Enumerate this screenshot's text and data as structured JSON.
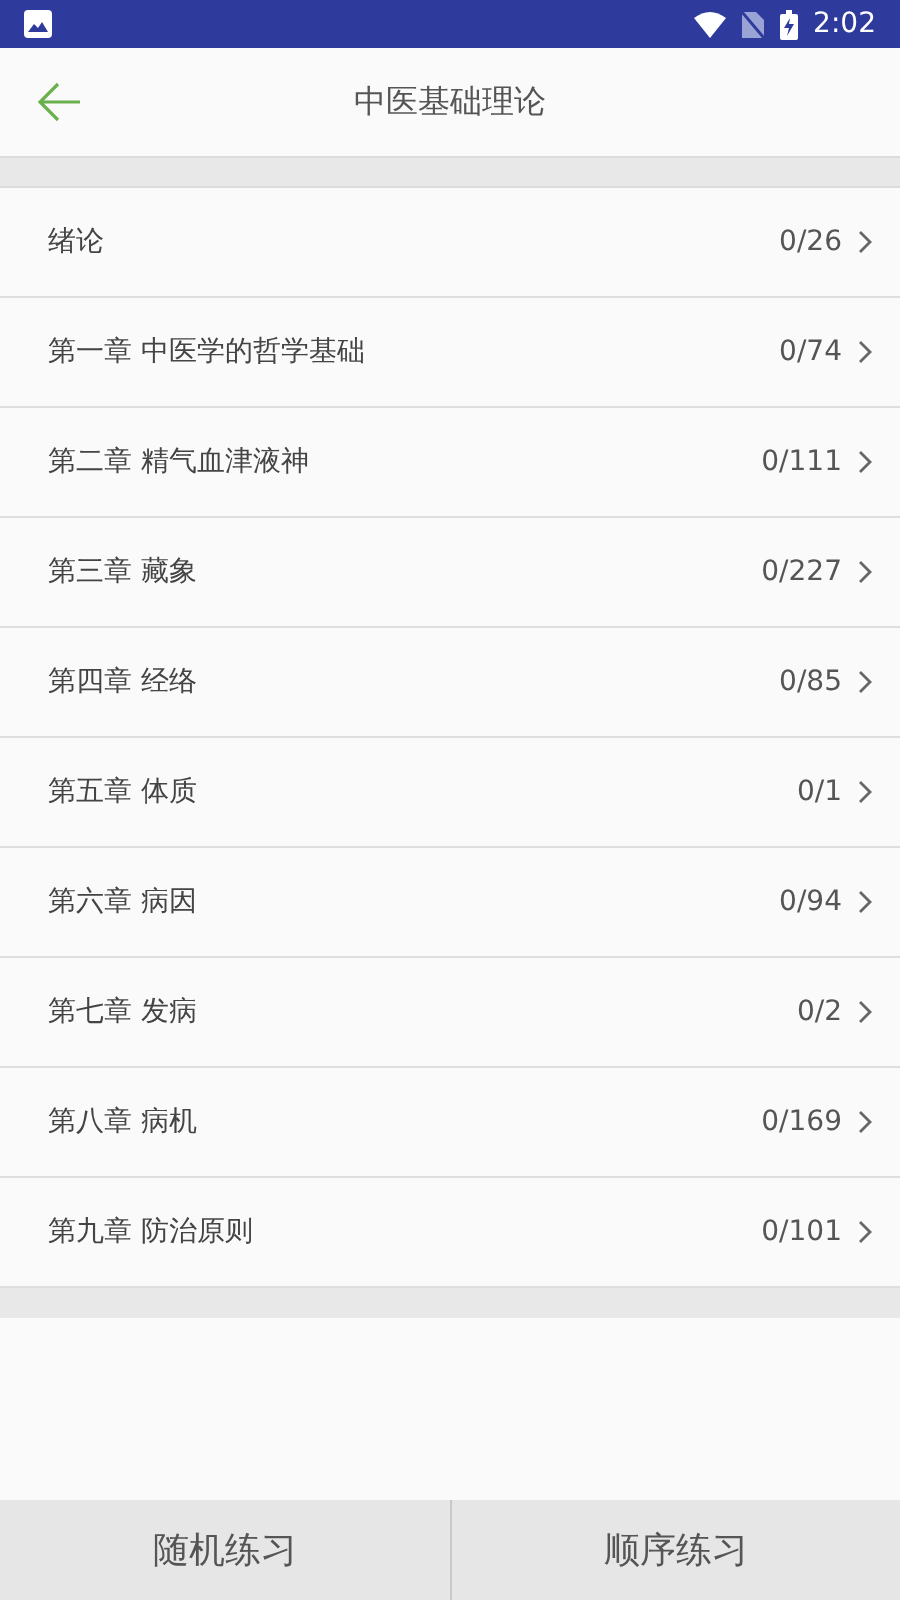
{
  "status_bar": {
    "time": "2:02"
  },
  "header": {
    "title": "中医基础理论"
  },
  "chapters": [
    {
      "title": "绪论",
      "progress": "0/26"
    },
    {
      "title": "第一章 中医学的哲学基础",
      "progress": "0/74"
    },
    {
      "title": "第二章 精气血津液神",
      "progress": "0/111"
    },
    {
      "title": "第三章 藏象",
      "progress": "0/227"
    },
    {
      "title": "第四章 经络",
      "progress": "0/85"
    },
    {
      "title": "第五章 体质",
      "progress": "0/1"
    },
    {
      "title": "第六章 病因",
      "progress": "0/94"
    },
    {
      "title": "第七章 发病",
      "progress": "0/2"
    },
    {
      "title": "第八章 病机",
      "progress": "0/169"
    },
    {
      "title": "第九章 防治原则",
      "progress": "0/101"
    }
  ],
  "bottom_buttons": [
    "随机练习",
    "顺序练习"
  ]
}
